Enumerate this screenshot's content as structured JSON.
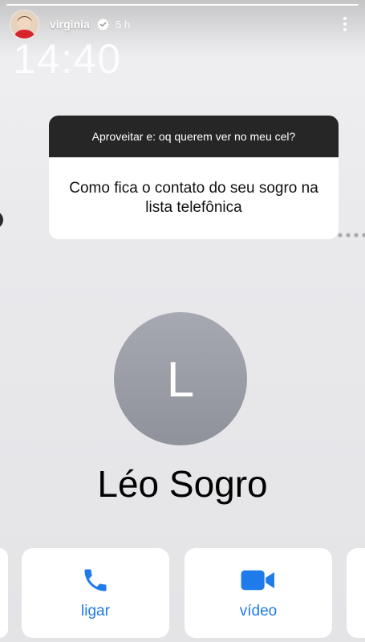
{
  "story": {
    "username": "virginia",
    "time_ago": "5 h",
    "progress": 1.0,
    "clock": "14:40",
    "icons": {
      "verified": "verified-badge-icon",
      "more": "more-options-icon",
      "dots": "ellipsis-icon"
    }
  },
  "question": {
    "prompt": "Aproveitar e: oq querem ver no meu cel?",
    "answer": "Como fica o contato do seu sogro na lista telefônica"
  },
  "contact": {
    "initial": "L",
    "name": "Léo Sogro"
  },
  "actions": {
    "call_label": "ligar",
    "video_label": "vídeo",
    "accent_color": "#1f7bea"
  }
}
